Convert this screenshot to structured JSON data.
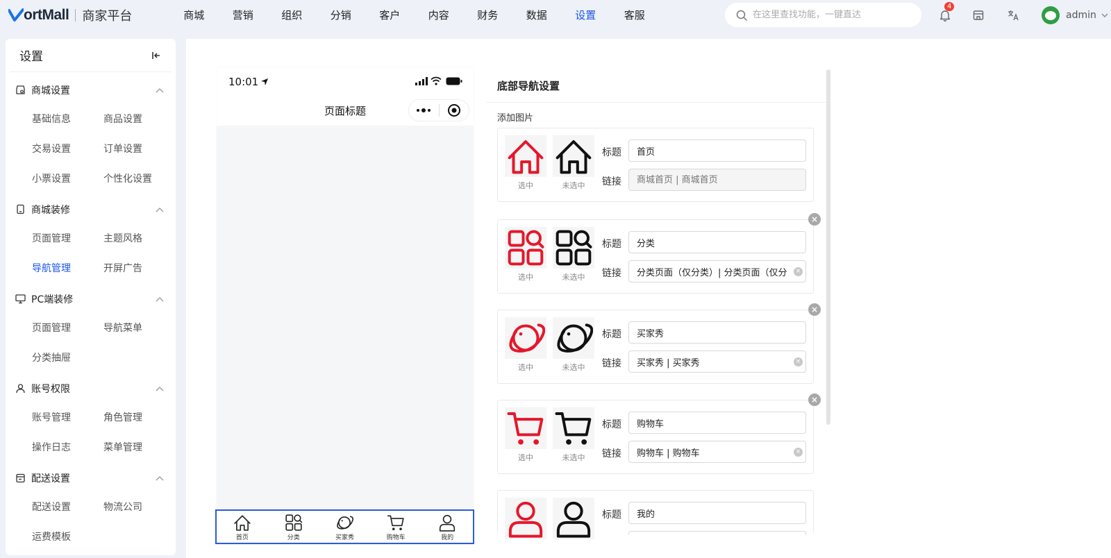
{
  "brand": {
    "logo_text": "ortMall",
    "logo_v": "V",
    "subtitle": "商家平台"
  },
  "main_nav": [
    "商城",
    "营销",
    "组织",
    "分销",
    "客户",
    "内容",
    "财务",
    "数据",
    "设置",
    "客服"
  ],
  "main_nav_active": "设置",
  "search": {
    "placeholder": "在这里查找功能，一键直达"
  },
  "notifications": {
    "count": "4"
  },
  "user": {
    "name": "admin"
  },
  "sidebar": {
    "title": "设置",
    "groups": [
      {
        "label": "商城设置",
        "icon": "shop-settings-icon",
        "items": [
          "基础信息",
          "商品设置",
          "交易设置",
          "订单设置",
          "小票设置",
          "个性化设置"
        ]
      },
      {
        "label": "商城装修",
        "icon": "mobile-icon",
        "items": [
          "页面管理",
          "主题风格",
          "导航管理",
          "开屏广告"
        ]
      },
      {
        "label": "PC端装修",
        "icon": "desktop-icon",
        "items": [
          "页面管理",
          "导航菜单",
          "分类抽屉"
        ]
      },
      {
        "label": "账号权限",
        "icon": "user-permission-icon",
        "items": [
          "账号管理",
          "角色管理",
          "操作日志",
          "菜单管理"
        ]
      },
      {
        "label": "配送设置",
        "icon": "delivery-icon",
        "items": [
          "配送设置",
          "物流公司",
          "运费模板"
        ]
      }
    ],
    "active_item": "导航管理"
  },
  "phone": {
    "time": "10:01",
    "page_title": "页面标题"
  },
  "tabbar": [
    {
      "label": "首页",
      "icon": "home-icon"
    },
    {
      "label": "分类",
      "icon": "category-icon"
    },
    {
      "label": "买家秀",
      "icon": "planet-icon"
    },
    {
      "label": "购物车",
      "icon": "cart-icon"
    },
    {
      "label": "我的",
      "icon": "user-icon"
    }
  ],
  "panel": {
    "title": "底部导航设置",
    "sub": "添加图片",
    "selected_caption": "选中",
    "unselected_caption": "未选中",
    "title_label": "标题",
    "link_label": "链接",
    "link_placeholder": "商城首页 | 商城首页",
    "items": [
      {
        "title": "首页",
        "link": "",
        "icon": "home-icon"
      },
      {
        "title": "分类",
        "link": "分类页面（仅分类）| 分类页面（仅分类）",
        "icon": "category-icon"
      },
      {
        "title": "买家秀",
        "link": "买家秀 | 买家秀",
        "icon": "planet-icon"
      },
      {
        "title": "购物车",
        "link": "购物车 | 购物车",
        "icon": "cart-icon"
      },
      {
        "title": "我的",
        "link": "",
        "icon": "user-icon"
      }
    ]
  },
  "colors": {
    "accent": "#1a56e8",
    "selected_icon": "#e5172b",
    "unselected_icon": "#111111"
  }
}
